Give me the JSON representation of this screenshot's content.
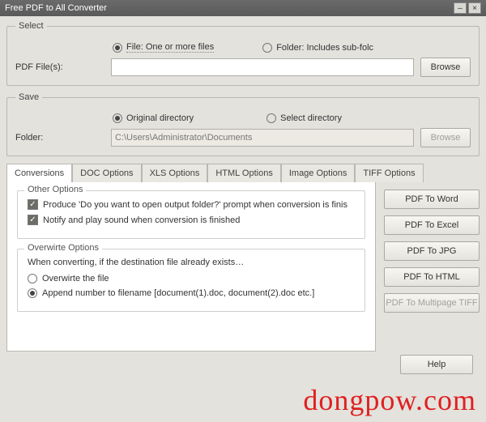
{
  "window": {
    "title": "Free PDF to All Converter"
  },
  "select": {
    "legend": "Select",
    "file_option": "File:  One or more files",
    "folder_option": "Folder: Includes sub-folc",
    "pdf_files_label": "PDF File(s):",
    "pdf_files_value": "",
    "browse": "Browse"
  },
  "save": {
    "legend": "Save",
    "original_option": "Original directory",
    "select_option": "Select directory",
    "folder_label": "Folder:",
    "folder_value": "C:\\Users\\Administrator\\Documents",
    "browse": "Browse"
  },
  "tabs": {
    "conversions": "Conversions",
    "doc": "DOC Options",
    "xls": "XLS Options",
    "html": "HTML Options",
    "image": "Image Options",
    "tiff": "TIFF Options"
  },
  "other": {
    "legend": "Other Options",
    "prompt": "Produce 'Do you want to open output folder?' prompt when conversion is finis",
    "notify": "Notify and play sound when conversion is finished"
  },
  "overwrite": {
    "legend": "Overwirte Options",
    "intro": "When converting, if the destination file already exists…",
    "opt1": "Overwirte the file",
    "opt2": "Append number to filename  [document(1).doc, document(2).doc etc.]"
  },
  "actions": {
    "word": "PDF To Word",
    "excel": "PDF To Excel",
    "jpg": "PDF To JPG",
    "html": "PDF To HTML",
    "tiff": "PDF To Multipage TIFF",
    "help": "Help"
  },
  "watermark": "dongpow.com"
}
